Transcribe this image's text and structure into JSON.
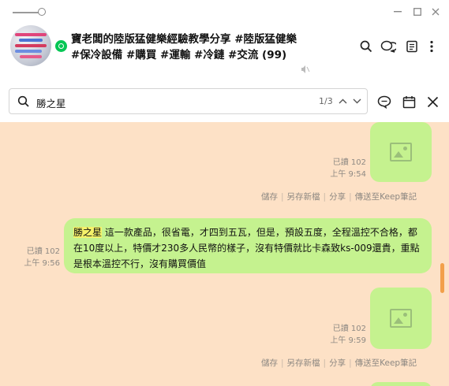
{
  "header": {
    "title": "寶老闆的陸版猛健樂經驗教學分享 #陸版猛健樂 #保冷設備 #購買 #運輸 #冷鏈 #交流 (99)"
  },
  "search": {
    "query": "勝之星",
    "count": "1/3"
  },
  "messages": [
    {
      "type": "image",
      "read": "已讀 102",
      "time": "上午 9:54"
    },
    {
      "type": "text",
      "read": "已讀 102",
      "time": "上午 9:56",
      "highlight": "勝之星",
      "text": "這一款產品，很省電，才四到五瓦，但是，預設五度，全程溫控不合格，都在10度以上，特價才230多人民幣的樣子，沒有特價就比卡森致ks-009還貴，重點是根本溫控不行，沒有購買價值"
    },
    {
      "type": "image",
      "read": "已讀 102",
      "time": "上午 9:59"
    }
  ],
  "actions": {
    "save": "儲存",
    "save_as": "另存新檔",
    "share": "分享",
    "keep": "傳送至Keep筆記"
  }
}
